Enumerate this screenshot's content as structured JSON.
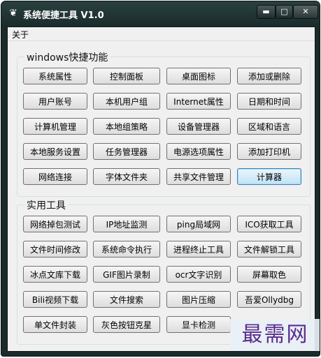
{
  "window": {
    "title": "系统便捷工具 V1.0",
    "app_icon": "app-icon",
    "minimize": "▬",
    "maximize": "□",
    "close": "✕"
  },
  "menu": {
    "about": "关于"
  },
  "groups": [
    {
      "title": "windows快捷功能",
      "buttons": [
        "系统属性",
        "控制面板",
        "桌面图标",
        "添加或删除",
        "用户账号",
        "本机用户组",
        "Internet属性",
        "日期和时间",
        "计算机管理",
        "本地组策略",
        "设备管理器",
        "区域和语言",
        "本地服务设置",
        "任务管理器",
        "电源选项属性",
        "添加打印机",
        "网络连接",
        "字体文件夹",
        "共享文件管理",
        "计算器"
      ],
      "selected": "计算器"
    },
    {
      "title": "实用工具",
      "buttons": [
        "网络掉包测试",
        "IP地址监测",
        "ping局域网",
        "ICO获取工具",
        "文件时间修改",
        "系统命令执行",
        "进程终止工具",
        "文件解锁工具",
        "冰点文库下载",
        "GIF图片录制",
        "ocr文字识别",
        "屏幕取色",
        "Bili视频下载",
        "文件搜索",
        "图片压缩",
        "吾爱Ollydbg",
        "单文件封装",
        "灰色按钮克星",
        "显卡检测",
        ""
      ]
    }
  ],
  "watermark": "最需网",
  "colors": {
    "titlebar": "#1b2a2a",
    "client": "#f0f0f0",
    "selected_border": "#3c7fb1",
    "watermark_text": "#5a2d8c"
  }
}
